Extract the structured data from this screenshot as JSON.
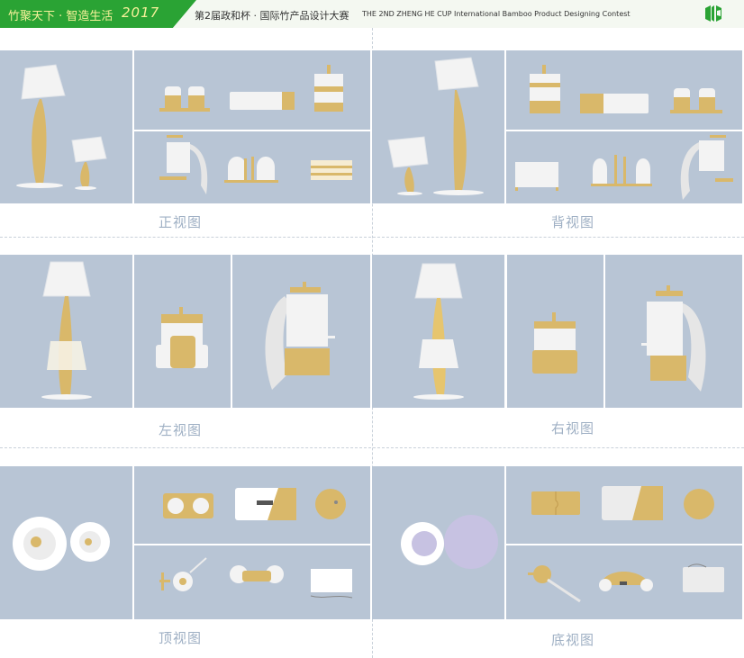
{
  "header": {
    "brand_text": "竹聚天下 · 智造生活",
    "brand_year": "2017",
    "contest_cn": "第2届政和杯 · 国际竹产品设计大赛",
    "contest_en": "THE 2ND ZHENG HE CUP International Bamboo Product Designing Contest",
    "logo_icon": "bamboo-logo-icon"
  },
  "views": {
    "front": "正视图",
    "back": "背视图",
    "left": "左视图",
    "right": "右视图",
    "top": "顶视图",
    "bottom": "底视图"
  },
  "colors": {
    "brand_green": "#2aa334",
    "brand_text": "#f7f19a",
    "panel_bg": "#b8c5d5",
    "label": "#9fb0c4",
    "bamboo": "#d9b86a",
    "white_part": "#f2f2f2"
  }
}
